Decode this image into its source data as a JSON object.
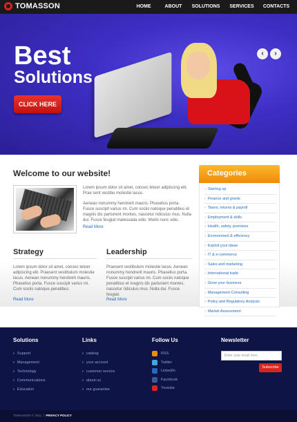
{
  "brand": {
    "name": "TOMASSON"
  },
  "nav": [
    "HOME",
    "ABOUT",
    "SOLUTIONS",
    "SERVICES",
    "CONTACTS"
  ],
  "hero": {
    "title1": "Best",
    "title2": "Solutions",
    "button": "CLICK HERE",
    "prev": "‹",
    "next": "›"
  },
  "welcome": {
    "title": "Welcome to our website!",
    "para1": "Lorem ipsum dolor sit amet, consec tetuer adipiscing elit. Prae sent vestibu molestie lacus.",
    "para2": "Aenean nonummy hendrerit mauris. Phasellus porta. Fusce suscipit varius mi. Cum sociis natoque penatibus et magnis dis parturient montes, nascetur ridiculus mus. Nulla dui. Fusce feugiat malesuada odio. Morbi nunc odio.",
    "readmore": "Read More"
  },
  "strategy": {
    "title": "Strategy",
    "text": "Lorem ipsum dolor sit amet, consec tetuer adipiscing elit. Praesent vestibulum molestie lacus. Aenean nonummy hendrerit mauris. Phasellus porta. Fusce suscipit varius mi. Cum sociis natoque penatibus.",
    "readmore": "Read More"
  },
  "leadership": {
    "title": "Leadership",
    "text": "Praesent vestibulum molestie lacus. Aenean nonummy hendrerit mauris. Phasellus porta. Fusce suscipit varius mi. Cum sociis natoque penatibus et magnis dis parturient montes, nascetur ridiculus mus. Nulla dui. Fusce feugiat.",
    "readmore": "Read More"
  },
  "categories": {
    "title": "Categories",
    "items": [
      "Starting up",
      "Finance and grants",
      "Taxes, returns & payroll",
      "Employment & skills",
      "Health, safety, premises",
      "Environment & efficiency",
      "Exploit your ideas",
      "IT & e-commerce",
      "Sales and marketing",
      "International trade",
      "Grow your business",
      "Management Consulting",
      "Policy and Regulatory Analysis",
      "Market Assessment"
    ]
  },
  "footer": {
    "solutions": {
      "title": "Solutions",
      "items": [
        "Support",
        "Management",
        "Technology",
        "Communications",
        "Education"
      ]
    },
    "links": {
      "title": "Links",
      "items": [
        "catalog",
        "your account",
        "customer service",
        "about us",
        "our guarantee"
      ]
    },
    "follow": {
      "title": "Follow Us",
      "items": [
        {
          "label": "RSS",
          "color": "#f08a0c"
        },
        {
          "label": "Twitter",
          "color": "#39a9e0"
        },
        {
          "label": "LinkedIn",
          "color": "#1f6bbf"
        },
        {
          "label": "Facebook",
          "color": "#3b5998"
        },
        {
          "label": "Youtube",
          "color": "#d8231f"
        }
      ]
    },
    "newsletter": {
      "title": "Newsletter",
      "placeholder": "Enter your email here",
      "button": "Subscribe"
    }
  },
  "bottom": {
    "copyright": "TOMASSON © 2011",
    "privacy": "PRIVACY POLICY"
  }
}
